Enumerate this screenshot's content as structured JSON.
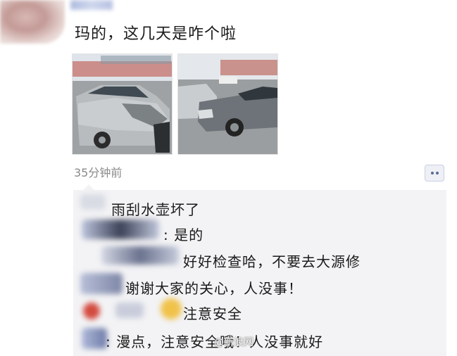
{
  "post": {
    "text": "玛的，这几天是咋个啦",
    "time": "35分钟前"
  },
  "comments": [
    {
      "text": "雨刮水壶坏了"
    },
    {
      "text": ": 是的"
    },
    {
      "text": "好好检查哈，不要去大源修"
    },
    {
      "text": "谢谢大家的关心，人没事！"
    },
    {
      "text": "注意安全"
    },
    {
      "text": ": 漫点，注意安全哦！人没事就好"
    }
  ],
  "watermark": "@新浪网",
  "icons": {
    "comment": "comment-bubble-icon"
  }
}
